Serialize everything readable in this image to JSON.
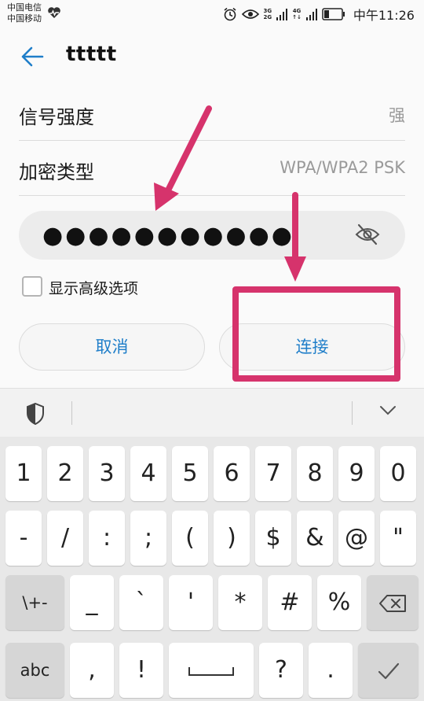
{
  "status_bar": {
    "carrier_1": "中国电信",
    "carrier_2": "中国移动",
    "net_1_top": "3G",
    "net_1_bottom": "2G",
    "net_2_top": "4G",
    "time": "中午11:26"
  },
  "header": {
    "network_name": "ttttt"
  },
  "info": {
    "signal_label": "信号强度",
    "signal_value": "强",
    "security_label": "加密类型",
    "security_value": "WPA/WPA2 PSK"
  },
  "password": {
    "value": "●●●●●●●●●●●"
  },
  "advanced": {
    "label": "显示高级选项",
    "checked": false
  },
  "actions": {
    "cancel_label": "取消",
    "connect_label": "连接"
  },
  "annotation": {
    "color": "#d6336c"
  },
  "keyboard": {
    "row1": [
      "1",
      "2",
      "3",
      "4",
      "5",
      "6",
      "7",
      "8",
      "9",
      "0"
    ],
    "row2": [
      "-",
      "/",
      ":",
      ";",
      "(",
      ")",
      "$",
      "&",
      "@",
      "\""
    ],
    "row3": {
      "mode_key": "\\+-",
      "symbols": [
        "_",
        "`",
        "'",
        "*",
        "#",
        "%"
      ]
    },
    "row4": {
      "abc_key": "abc",
      "symbols": [
        ",",
        "!",
        "?",
        "."
      ]
    }
  },
  "colors": {
    "accent": "#1f7ec9",
    "annotation": "#d6336c"
  }
}
